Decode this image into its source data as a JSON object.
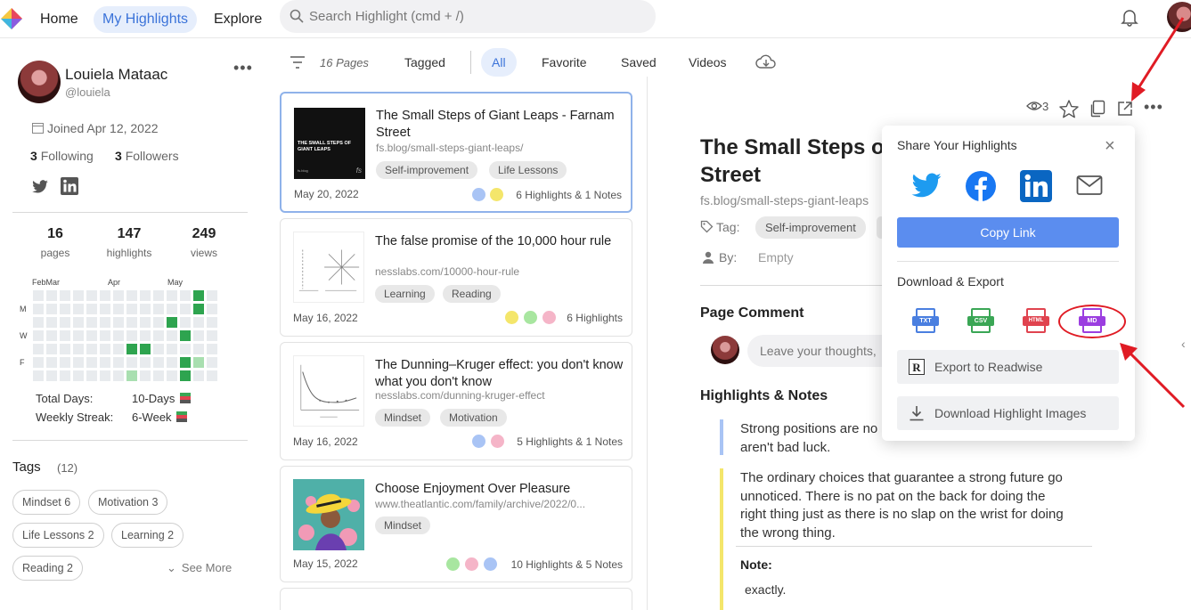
{
  "nav": {
    "home": "Home",
    "my_highlights": "My Highlights",
    "explore": "Explore",
    "search_placeholder": "Search Highlight (cmd + /)"
  },
  "profile": {
    "name": "Louiela Mataac",
    "handle": "@louiela",
    "joined": "Joined Apr 12, 2022",
    "following_count": "3",
    "following_label": "Following",
    "followers_count": "3",
    "followers_label": "Followers",
    "stats": [
      {
        "num": "16",
        "label": "pages"
      },
      {
        "num": "147",
        "label": "highlights"
      },
      {
        "num": "249",
        "label": "views"
      }
    ],
    "heatmap": {
      "months": [
        "FebMar",
        "Apr",
        "May"
      ],
      "days": [
        "M",
        "W",
        "F"
      ],
      "green": "#2ea44f",
      "light_green": "#a9dfb0"
    },
    "total_days_label": "Total Days:",
    "total_days_value": "10-Days",
    "weekly_streak_label": "Weekly Streak:",
    "weekly_streak_value": "6-Week"
  },
  "tags": {
    "title": "Tags",
    "count": "(12)",
    "items": [
      "Mindset 6",
      "Motivation 3",
      "Life Lessons 2",
      "Learning 2",
      "Reading 2"
    ],
    "see_more": "See More"
  },
  "list": {
    "pages_count": "16 Pages",
    "tabs": [
      "Tagged",
      "All",
      "Favorite",
      "Saved",
      "Videos"
    ],
    "active_tab": "All",
    "cards": [
      {
        "title": "The Small Steps of Giant Leaps - Farnam Street",
        "url": "fs.blog/small-steps-giant-leaps/",
        "tags": [
          "Self-improvement",
          "Life Lessons"
        ],
        "date": "May 20, 2022",
        "dot_colors": [
          "#a9c4f5",
          "#f4e66b"
        ],
        "summary": "6 Highlights & 1 Notes",
        "thumb_text": "THE SMALL STEPS OF GIANT LEAPS",
        "thumb_brand": "fs.blog",
        "thumb_mark": "fs"
      },
      {
        "title": "The false promise of the 10,000 hour rule",
        "url": "nesslabs.com/10000-hour-rule",
        "tags": [
          "Learning",
          "Reading"
        ],
        "date": "May 16, 2022",
        "dot_colors": [
          "#f4e66b",
          "#a8e6a0",
          "#f5b5c8"
        ],
        "summary": "6 Highlights"
      },
      {
        "title": "The Dunning–Kruger effect: you don't know what you don't know",
        "url": "nesslabs.com/dunning-kruger-effect",
        "tags": [
          "Mindset",
          "Motivation"
        ],
        "date": "May 16, 2022",
        "dot_colors": [
          "#a9c4f5",
          "#f5b5c8"
        ],
        "summary": "5 Highlights & 1 Notes"
      },
      {
        "title": "Choose Enjoyment Over Pleasure",
        "url": "www.theatlantic.com/family/archive/2022/0...",
        "tags": [
          "Mindset"
        ],
        "date": "May 15, 2022",
        "dot_colors": [
          "#a8e6a0",
          "#f5b5c8",
          "#a9c4f5"
        ],
        "summary": "10 Highlights & 5 Notes"
      }
    ]
  },
  "article": {
    "title_line1": "The Small Steps o",
    "title_line2": "Street",
    "url": "fs.blog/small-steps-giant-leaps",
    "tag_label": "Tag:",
    "tag": "Self-improvement",
    "by_label": "By:",
    "by_value": "Empty",
    "views": "3",
    "page_comment": "Page Comment",
    "comment_placeholder": "Leave your thoughts,",
    "highlights_title": "Highlights & Notes",
    "highlights": [
      {
        "color": "#a9c4f5",
        "lines": [
          "Strong positions are no",
          "aren't bad luck."
        ]
      },
      {
        "color": "#f4e66b",
        "lines": [
          "The ordinary choices that guarantee a strong future go",
          "unnoticed. There is no pat on the back for doing the",
          "right thing just as there is no slap on the wrist for doing",
          "the wrong thing."
        ]
      }
    ],
    "note_label": "Note:",
    "note_text": "exactly."
  },
  "share": {
    "title": "Share Your Highlights",
    "copy_link": "Copy Link",
    "download_title": "Download & Export",
    "formats": [
      "TXT",
      "CSV",
      "HTML",
      "MD"
    ],
    "format_colors": [
      "#4a7fe0",
      "#3aa655",
      "#e0434f",
      "#9b3ee0"
    ],
    "export_readwise": "Export to Readwise",
    "download_images": "Download Highlight Images",
    "social_colors": {
      "twitter": "#1d9bf0",
      "facebook": "#1877f2",
      "linkedin": "#0a66c2",
      "mail": "#555555"
    }
  },
  "annotation_color": "#e01b24"
}
